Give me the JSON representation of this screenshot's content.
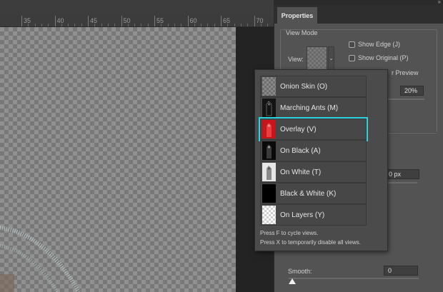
{
  "ruler": {
    "labels": [
      "35",
      "40",
      "45",
      "50",
      "55",
      "60",
      "65",
      "70"
    ]
  },
  "panel": {
    "tab_title": "Properties",
    "collapse_glyph": "»",
    "view_mode_title": "View Mode",
    "view_label": "View:",
    "show_edge": "Show Edge (J)",
    "show_original": "Show Original (P)",
    "preview_partial": "r Preview",
    "opacity_value": "20%",
    "radius_partial": "0 px",
    "smooth_label": "Smooth:",
    "smooth_value": "0"
  },
  "popup": {
    "options": [
      {
        "label": "Onion Skin (O)",
        "thumb": "onion-skin",
        "state": "selected"
      },
      {
        "label": "Marching Ants (M)",
        "thumb": "marching-ants",
        "state": "normal"
      },
      {
        "label": "Overlay (V)",
        "thumb": "overlay",
        "state": "hover"
      },
      {
        "label": "On Black (A)",
        "thumb": "on-black",
        "state": "normal"
      },
      {
        "label": "On White (T)",
        "thumb": "on-white",
        "state": "normal"
      },
      {
        "label": "Black & White (K)",
        "thumb": "black-white",
        "state": "normal"
      },
      {
        "label": "On Layers (Y)",
        "thumb": "on-layers",
        "state": "normal"
      }
    ],
    "hint_cycle": "Press F to cycle views.",
    "hint_disable": "Press X to temporarily disable all views."
  },
  "colors": {
    "highlight": "#2ad4de",
    "overlay_red": "#c8141a"
  }
}
